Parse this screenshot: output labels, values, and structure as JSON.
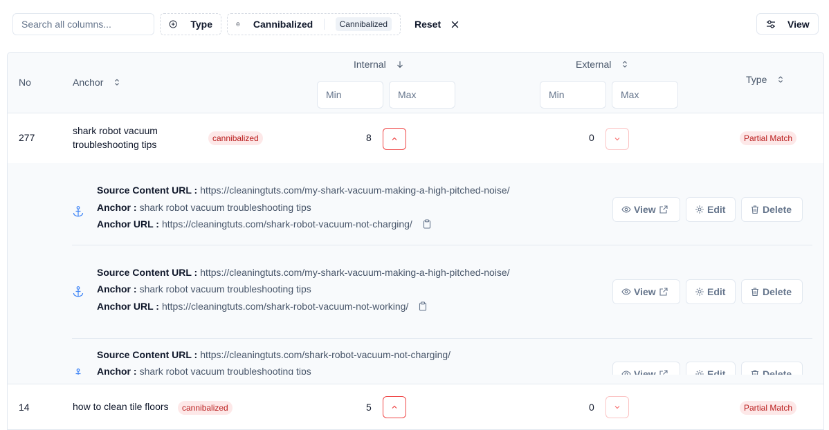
{
  "toolbar": {
    "search_placeholder": "Search all columns...",
    "type_filter_label": "Type",
    "cannibalized_filter_label": "Cannibalized",
    "cannibalized_chip": "Cannibalized",
    "reset_label": "Reset",
    "view_label": "View"
  },
  "table": {
    "columns": {
      "no": "No",
      "anchor": "Anchor",
      "internal": "Internal",
      "external": "External",
      "type": "Type"
    },
    "min_placeholder": "Min",
    "max_placeholder": "Max",
    "rows": [
      {
        "no": "277",
        "anchor_line1": "shark robot vacuum",
        "anchor_line2": "troubleshooting tips",
        "badge": "cannibalized",
        "internal": "8",
        "external": "0",
        "type": "Partial Match",
        "expanded": true,
        "links": [
          {
            "source_label": "Source Content URL :",
            "source_url": "https://cleaningtuts.com/my-shark-vacuum-making-a-high-pitched-noise/",
            "anchor_label": "Anchor :",
            "anchor_text": "shark robot vacuum troubleshooting tips",
            "anchor_url_label": "Anchor URL :",
            "anchor_url": "https://cleaningtuts.com/shark-robot-vacuum-not-charging/"
          },
          {
            "source_label": "Source Content URL :",
            "source_url": "https://cleaningtuts.com/my-shark-vacuum-making-a-high-pitched-noise/",
            "anchor_label": "Anchor :",
            "anchor_text": "shark robot vacuum troubleshooting tips",
            "anchor_url_label": "Anchor URL :",
            "anchor_url": "https://cleaningtuts.com/shark-robot-vacuum-not-working/"
          },
          {
            "source_label": "Source Content URL :",
            "source_url": "https://cleaningtuts.com/shark-robot-vacuum-not-charging/",
            "anchor_label": "Anchor :",
            "anchor_text": "shark robot vacuum troubleshooting tips"
          }
        ]
      },
      {
        "no": "14",
        "anchor": "how to clean tile floors",
        "badge": "cannibalized",
        "internal": "5",
        "external": "0",
        "type": "Partial Match"
      }
    ]
  },
  "actions": {
    "view": "View",
    "edit": "Edit",
    "delete": "Delete"
  },
  "colors": {
    "accent_red": "#ef4444",
    "badge_bg": "#fde8e8",
    "badge_text": "#b91c1c",
    "border": "#e2e8f0",
    "anchor_icon": "#3b82f6"
  }
}
